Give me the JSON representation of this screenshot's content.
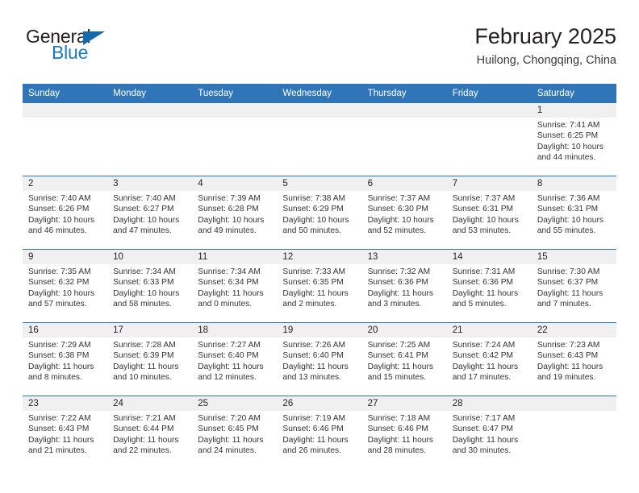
{
  "logo": {
    "word_top": "General",
    "word_bottom": "Blue",
    "triangle_color": "#1469b0",
    "blue_color": "#1b7ac4"
  },
  "header": {
    "title": "February 2025",
    "location": "Huilong, Chongqing, China"
  },
  "theme": {
    "header_blue": "#3075b8",
    "row_divider_blue": "#2e75b6",
    "daynum_band_gray": "#f0f0f0",
    "text_color": "#231f20"
  },
  "weekdays": [
    "Sunday",
    "Monday",
    "Tuesday",
    "Wednesday",
    "Thursday",
    "Friday",
    "Saturday"
  ],
  "weeks": [
    [
      {
        "day": "",
        "empty": true
      },
      {
        "day": "",
        "empty": true
      },
      {
        "day": "",
        "empty": true
      },
      {
        "day": "",
        "empty": true
      },
      {
        "day": "",
        "empty": true
      },
      {
        "day": "",
        "empty": true
      },
      {
        "day": "1",
        "sunrise": "Sunrise: 7:41 AM",
        "sunset": "Sunset: 6:25 PM",
        "daylight_1": "Daylight: 10 hours",
        "daylight_2": "and 44 minutes."
      }
    ],
    [
      {
        "day": "2",
        "sunrise": "Sunrise: 7:40 AM",
        "sunset": "Sunset: 6:26 PM",
        "daylight_1": "Daylight: 10 hours",
        "daylight_2": "and 46 minutes."
      },
      {
        "day": "3",
        "sunrise": "Sunrise: 7:40 AM",
        "sunset": "Sunset: 6:27 PM",
        "daylight_1": "Daylight: 10 hours",
        "daylight_2": "and 47 minutes."
      },
      {
        "day": "4",
        "sunrise": "Sunrise: 7:39 AM",
        "sunset": "Sunset: 6:28 PM",
        "daylight_1": "Daylight: 10 hours",
        "daylight_2": "and 49 minutes."
      },
      {
        "day": "5",
        "sunrise": "Sunrise: 7:38 AM",
        "sunset": "Sunset: 6:29 PM",
        "daylight_1": "Daylight: 10 hours",
        "daylight_2": "and 50 minutes."
      },
      {
        "day": "6",
        "sunrise": "Sunrise: 7:37 AM",
        "sunset": "Sunset: 6:30 PM",
        "daylight_1": "Daylight: 10 hours",
        "daylight_2": "and 52 minutes."
      },
      {
        "day": "7",
        "sunrise": "Sunrise: 7:37 AM",
        "sunset": "Sunset: 6:31 PM",
        "daylight_1": "Daylight: 10 hours",
        "daylight_2": "and 53 minutes."
      },
      {
        "day": "8",
        "sunrise": "Sunrise: 7:36 AM",
        "sunset": "Sunset: 6:31 PM",
        "daylight_1": "Daylight: 10 hours",
        "daylight_2": "and 55 minutes."
      }
    ],
    [
      {
        "day": "9",
        "sunrise": "Sunrise: 7:35 AM",
        "sunset": "Sunset: 6:32 PM",
        "daylight_1": "Daylight: 10 hours",
        "daylight_2": "and 57 minutes."
      },
      {
        "day": "10",
        "sunrise": "Sunrise: 7:34 AM",
        "sunset": "Sunset: 6:33 PM",
        "daylight_1": "Daylight: 10 hours",
        "daylight_2": "and 58 minutes."
      },
      {
        "day": "11",
        "sunrise": "Sunrise: 7:34 AM",
        "sunset": "Sunset: 6:34 PM",
        "daylight_1": "Daylight: 11 hours",
        "daylight_2": "and 0 minutes."
      },
      {
        "day": "12",
        "sunrise": "Sunrise: 7:33 AM",
        "sunset": "Sunset: 6:35 PM",
        "daylight_1": "Daylight: 11 hours",
        "daylight_2": "and 2 minutes."
      },
      {
        "day": "13",
        "sunrise": "Sunrise: 7:32 AM",
        "sunset": "Sunset: 6:36 PM",
        "daylight_1": "Daylight: 11 hours",
        "daylight_2": "and 3 minutes."
      },
      {
        "day": "14",
        "sunrise": "Sunrise: 7:31 AM",
        "sunset": "Sunset: 6:36 PM",
        "daylight_1": "Daylight: 11 hours",
        "daylight_2": "and 5 minutes."
      },
      {
        "day": "15",
        "sunrise": "Sunrise: 7:30 AM",
        "sunset": "Sunset: 6:37 PM",
        "daylight_1": "Daylight: 11 hours",
        "daylight_2": "and 7 minutes."
      }
    ],
    [
      {
        "day": "16",
        "sunrise": "Sunrise: 7:29 AM",
        "sunset": "Sunset: 6:38 PM",
        "daylight_1": "Daylight: 11 hours",
        "daylight_2": "and 8 minutes."
      },
      {
        "day": "17",
        "sunrise": "Sunrise: 7:28 AM",
        "sunset": "Sunset: 6:39 PM",
        "daylight_1": "Daylight: 11 hours",
        "daylight_2": "and 10 minutes."
      },
      {
        "day": "18",
        "sunrise": "Sunrise: 7:27 AM",
        "sunset": "Sunset: 6:40 PM",
        "daylight_1": "Daylight: 11 hours",
        "daylight_2": "and 12 minutes."
      },
      {
        "day": "19",
        "sunrise": "Sunrise: 7:26 AM",
        "sunset": "Sunset: 6:40 PM",
        "daylight_1": "Daylight: 11 hours",
        "daylight_2": "and 13 minutes."
      },
      {
        "day": "20",
        "sunrise": "Sunrise: 7:25 AM",
        "sunset": "Sunset: 6:41 PM",
        "daylight_1": "Daylight: 11 hours",
        "daylight_2": "and 15 minutes."
      },
      {
        "day": "21",
        "sunrise": "Sunrise: 7:24 AM",
        "sunset": "Sunset: 6:42 PM",
        "daylight_1": "Daylight: 11 hours",
        "daylight_2": "and 17 minutes."
      },
      {
        "day": "22",
        "sunrise": "Sunrise: 7:23 AM",
        "sunset": "Sunset: 6:43 PM",
        "daylight_1": "Daylight: 11 hours",
        "daylight_2": "and 19 minutes."
      }
    ],
    [
      {
        "day": "23",
        "sunrise": "Sunrise: 7:22 AM",
        "sunset": "Sunset: 6:43 PM",
        "daylight_1": "Daylight: 11 hours",
        "daylight_2": "and 21 minutes."
      },
      {
        "day": "24",
        "sunrise": "Sunrise: 7:21 AM",
        "sunset": "Sunset: 6:44 PM",
        "daylight_1": "Daylight: 11 hours",
        "daylight_2": "and 22 minutes."
      },
      {
        "day": "25",
        "sunrise": "Sunrise: 7:20 AM",
        "sunset": "Sunset: 6:45 PM",
        "daylight_1": "Daylight: 11 hours",
        "daylight_2": "and 24 minutes."
      },
      {
        "day": "26",
        "sunrise": "Sunrise: 7:19 AM",
        "sunset": "Sunset: 6:46 PM",
        "daylight_1": "Daylight: 11 hours",
        "daylight_2": "and 26 minutes."
      },
      {
        "day": "27",
        "sunrise": "Sunrise: 7:18 AM",
        "sunset": "Sunset: 6:46 PM",
        "daylight_1": "Daylight: 11 hours",
        "daylight_2": "and 28 minutes."
      },
      {
        "day": "28",
        "sunrise": "Sunrise: 7:17 AM",
        "sunset": "Sunset: 6:47 PM",
        "daylight_1": "Daylight: 11 hours",
        "daylight_2": "and 30 minutes."
      },
      {
        "day": "",
        "empty": true
      }
    ]
  ]
}
